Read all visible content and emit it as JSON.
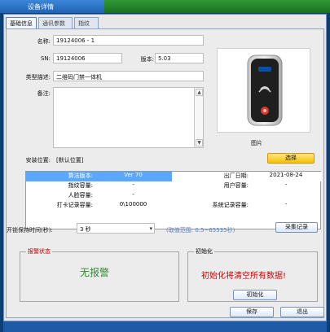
{
  "window": {
    "title": "设备详情"
  },
  "tabs": [
    {
      "label": "基础信息",
      "active": true
    },
    {
      "label": "通讯参数",
      "active": false
    },
    {
      "label": "指纹图",
      "active": false
    }
  ],
  "basic": {
    "name_label": "名称:",
    "name_value": "19124006 - 1",
    "sn_label": "SN:",
    "sn_value": "19124006",
    "version_label": "版本:",
    "version_value": "5.03",
    "type_label": "类型描述:",
    "type_value": "二维码门禁一体机",
    "note_label": "备注:",
    "note_value": "",
    "image_caption": "图片",
    "install_label": "安装位置:",
    "install_value": "[默认位置]",
    "choose_button": "选择"
  },
  "info": {
    "algo_label": "算法版本:",
    "algo_value": "Ver 70",
    "factory_date_label": "出厂日期:",
    "factory_date_value": "2021-08-24",
    "fingerprint_capacity_label": "指纹容量:",
    "fingerprint_capacity_value": "-",
    "user_capacity_label": "用户容量:",
    "user_capacity_value": "-",
    "face_capacity_label": "人脸容量:",
    "face_capacity_value": "-",
    "punch_capacity_label": "打卡记录容量:",
    "punch_capacity_value": "0\\100000",
    "system_capacity_label": "系统记录容量:",
    "system_capacity_value": "-"
  },
  "open_time": {
    "label": "开锁保持时间(秒):",
    "value": "3 秒",
    "range_hint": "(取值范围: 0.5~65535秒)",
    "collect_button": "采集记录"
  },
  "alarm": {
    "title": "报警状态",
    "value": "无报警"
  },
  "init": {
    "title": "初始化",
    "warning": "初始化将清空所有数据!",
    "button": "初始化"
  },
  "footer": {
    "save_button": "保存",
    "exit_button": "退出"
  },
  "icons": {
    "dropdown": "chevron-down-icon",
    "scroll_up": "chevron-up-icon",
    "scroll_down": "chevron-down-icon"
  },
  "colors": {
    "accent_blue": "#5aa7ff",
    "gold_button": "#f6c100",
    "alarm_title_red": "#c00000",
    "alarm_ok_green": "#2e8b2e",
    "init_warning_red": "#d00000"
  }
}
